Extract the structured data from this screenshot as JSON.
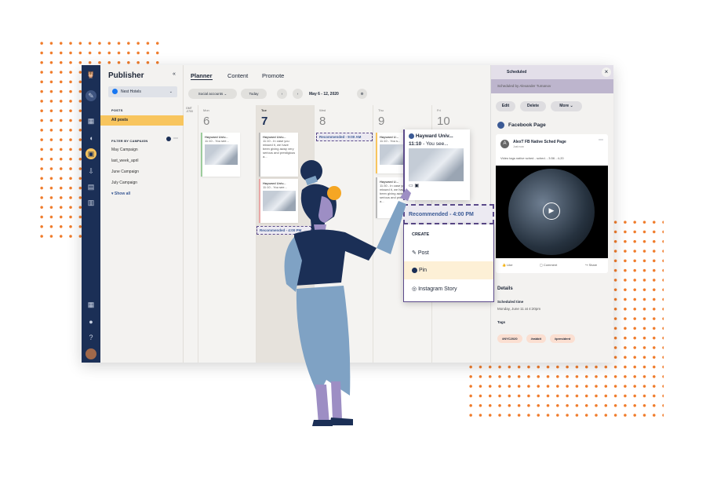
{
  "app": {
    "title": "Publisher",
    "account": "Nest Hotels"
  },
  "sidebar": {
    "posts_label": "POSTS",
    "all_posts": "All posts",
    "filter_label": "FILTER BY CAMPAIGN",
    "campaigns": [
      "May Campaign",
      "last_week_april",
      "June Campaign",
      "July Campaign"
    ],
    "show_all": "Show all"
  },
  "tabs": [
    "Planner",
    "Content",
    "Promote"
  ],
  "toolbar": {
    "social_accounts": "Social accounts",
    "today": "Today",
    "date_range": "May 6 - 12, 2020"
  },
  "calendar": {
    "tz": "GMT -0700",
    "days": [
      {
        "name": "Mon",
        "num": "6"
      },
      {
        "name": "Tue",
        "num": "7"
      },
      {
        "name": "Wed",
        "num": "8"
      },
      {
        "name": "Thu",
        "num": "9"
      },
      {
        "name": "Fri",
        "num": "10"
      }
    ],
    "cards": [
      {
        "title": "Hayward Univ...",
        "text": "11:10 - You see..."
      },
      {
        "title": "Hayward Univ...",
        "text": "11:10 - In case you missed it, we have been giving away very serious and prestigious a..."
      },
      {
        "title": "Hayward Univ...",
        "text": "11:10 - You see..."
      },
      {
        "title": "Hayward U...",
        "text": "11:10 - You s..."
      },
      {
        "title": "Hayward U...",
        "text": "11:30 - In case you missed it, we have been giving away very serious and prestigious a..."
      }
    ],
    "rec_wed": "Recommended - 9:00 AM",
    "rec_tue": "Recommended - 4:00 PM",
    "popup_card": {
      "title": "Hayward Univ...",
      "time": "11:10",
      "text": " - You see..."
    },
    "rec_main": "Recommended - 4:00 PM",
    "create": {
      "label": "CREATE",
      "items": [
        "Post",
        "Pin",
        "Instagram Story"
      ]
    }
  },
  "panel": {
    "status": "Scheduled",
    "by": "Scheduled by Alexander Tumanov",
    "buttons": [
      "Edit",
      "Delete",
      "More"
    ],
    "network": "Facebook Page",
    "page_name": "AlexT FB Native Sched Page",
    "time": "Just now",
    "avatar": "A",
    "caption": "Video tags native sched - sched. - 3:56 - 4-20",
    "actions": [
      "Like",
      "Comment",
      "Share"
    ],
    "details": "Details",
    "sched_label": "Scheduled time",
    "sched_value": "Monday, June 11 at 4:20pm",
    "tags_label": "Tags",
    "tags": [
      "#NYC2020",
      "#rabbit",
      "#president"
    ]
  },
  "colors": {
    "nav": "#1b2f56",
    "accent": "#f8c55e",
    "dots": "#f07b2a",
    "purple": "#5b4a8a"
  }
}
